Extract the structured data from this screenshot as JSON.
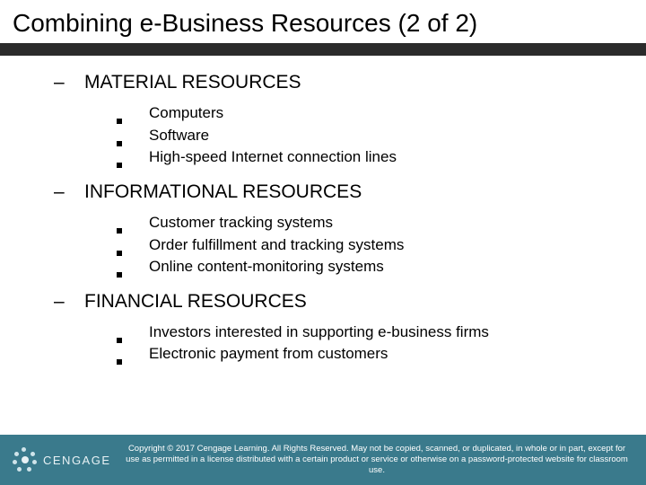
{
  "title": "Combining e-Business Resources (2 of 2)",
  "sections": [
    {
      "heading": "MATERIAL RESOURCES",
      "items": [
        "Computers",
        "Software",
        "High-speed Internet connection lines"
      ]
    },
    {
      "heading": "INFORMATIONAL RESOURCES",
      "items": [
        "Customer tracking systems",
        "Order fulfillment and tracking systems",
        "Online content-monitoring systems"
      ]
    },
    {
      "heading": "FINANCIAL RESOURCES",
      "items": [
        "Investors interested in supporting e-business firms",
        "Electronic payment from customers"
      ]
    }
  ],
  "brand": "CENGAGE",
  "copyright": "Copyright © 2017 Cengage Learning. All Rights Reserved. May not be copied, scanned, or duplicated, in whole or in part, except for use as permitted in a license distributed with a certain product or service or otherwise on a password-protected website for classroom use."
}
